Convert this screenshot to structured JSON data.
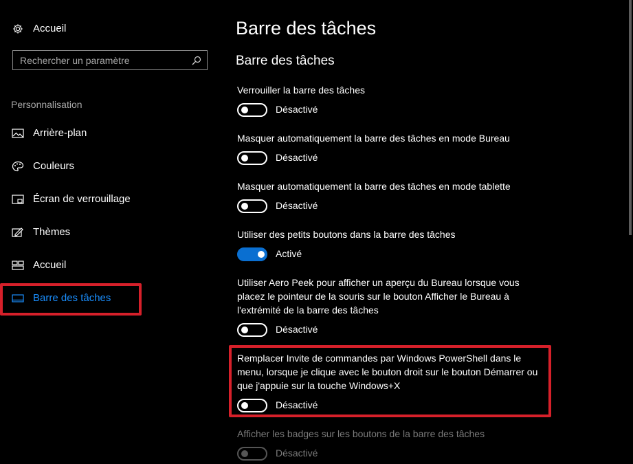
{
  "sidebar": {
    "home": {
      "label": "Accueil",
      "icon": "gear-icon"
    },
    "search": {
      "placeholder": "Rechercher un paramètre",
      "icon": "search-icon"
    },
    "section": "Personnalisation",
    "items": [
      {
        "label": "Arrière-plan",
        "icon": "picture-icon"
      },
      {
        "label": "Couleurs",
        "icon": "palette-icon"
      },
      {
        "label": "Écran de verrouillage",
        "icon": "lock-screen-icon"
      },
      {
        "label": "Thèmes",
        "icon": "brush-icon"
      },
      {
        "label": "Accueil",
        "icon": "start-icon"
      },
      {
        "label": "Barre des tâches",
        "icon": "taskbar-icon",
        "active": true
      }
    ]
  },
  "main": {
    "title": "Barre des tâches",
    "subtitle": "Barre des tâches",
    "settings": [
      {
        "text": "Verrouiller la barre des tâches",
        "state": "Désactivé",
        "on": false
      },
      {
        "text": "Masquer automatiquement la barre des tâches en mode Bureau",
        "state": "Désactivé",
        "on": false
      },
      {
        "text": "Masquer automatiquement la barre des tâches en mode tablette",
        "state": "Désactivé",
        "on": false
      },
      {
        "text": "Utiliser des petits boutons dans la barre des tâches",
        "state": "Activé",
        "on": true
      },
      {
        "text": "Utiliser Aero Peek pour afficher un aperçu du Bureau lorsque vous placez le pointeur de la souris sur le bouton Afficher le Bureau à l'extrémité de la barre des tâches",
        "state": "Désactivé",
        "on": false
      },
      {
        "text": "Remplacer Invite de commandes par Windows PowerShell dans le menu, lorsque je clique avec le bouton droit sur le bouton Démarrer ou que j'appuie sur la touche Windows+X",
        "state": "Désactivé",
        "on": false
      },
      {
        "text": "Afficher les badges sur les boutons de la barre des tâches",
        "state": "Désactivé",
        "on": false,
        "disabled": true
      }
    ]
  },
  "colors": {
    "accent": "#1a8fff",
    "toggle_on": "#0a6fd1",
    "highlight": "#d6202a",
    "background": "#000000"
  }
}
